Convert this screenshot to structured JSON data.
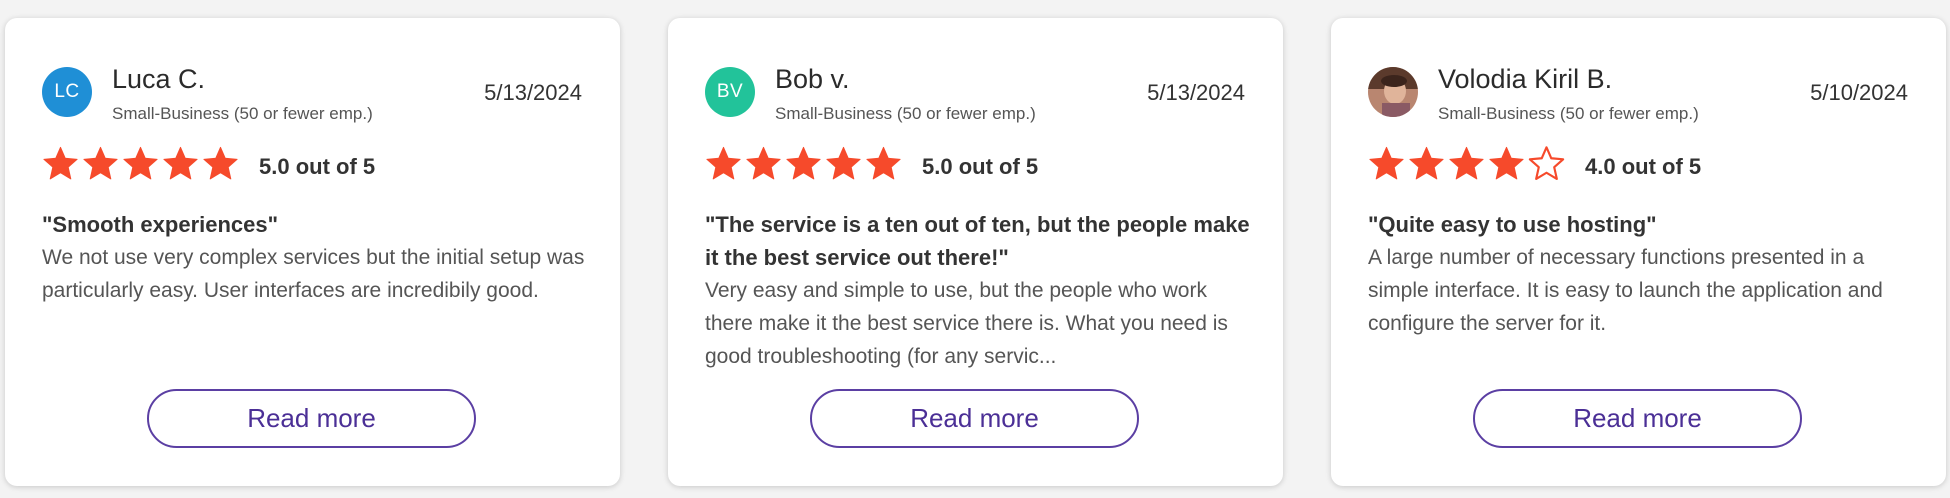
{
  "accent_colors": {
    "star": "#f64a2b",
    "button": "#4b2f96"
  },
  "reviews": [
    {
      "avatar_initials": "LC",
      "avatar_color": "#1f8fd6",
      "name": "Luca C.",
      "segment": "Small-Business (50 or fewer emp.)",
      "date": "5/13/2024",
      "rating": 5,
      "rating_text": "5.0 out of 5",
      "title": "\"Smooth experiences\"",
      "text": "We not use very complex services but the initial setup was particularly easy. User interfaces are incredibily good.",
      "button": "Read more"
    },
    {
      "avatar_initials": "BV",
      "avatar_color": "#22c39a",
      "name": "Bob v.",
      "segment": "Small-Business (50 or fewer emp.)",
      "date": "5/13/2024",
      "rating": 5,
      "rating_text": "5.0 out of 5",
      "title": "\"The service is a ten out of ten, but the people make it the best service out there!\"",
      "text": "Very easy and simple to use, but the people who work there make it the best service there is. What you need is good troubleshooting (for any servic...",
      "button": "Read more"
    },
    {
      "avatar_initials": "",
      "avatar_icon": "user-photo",
      "name": "Volodia Kiril B.",
      "segment": "Small-Business (50 or fewer emp.)",
      "date": "5/10/2024",
      "rating": 4,
      "rating_text": "4.0 out of 5",
      "title": "\"Quite easy to use hosting\"",
      "text": "A large number of necessary functions presented in a simple interface. It is easy to launch the application and configure the server for it.",
      "button": "Read more"
    }
  ]
}
